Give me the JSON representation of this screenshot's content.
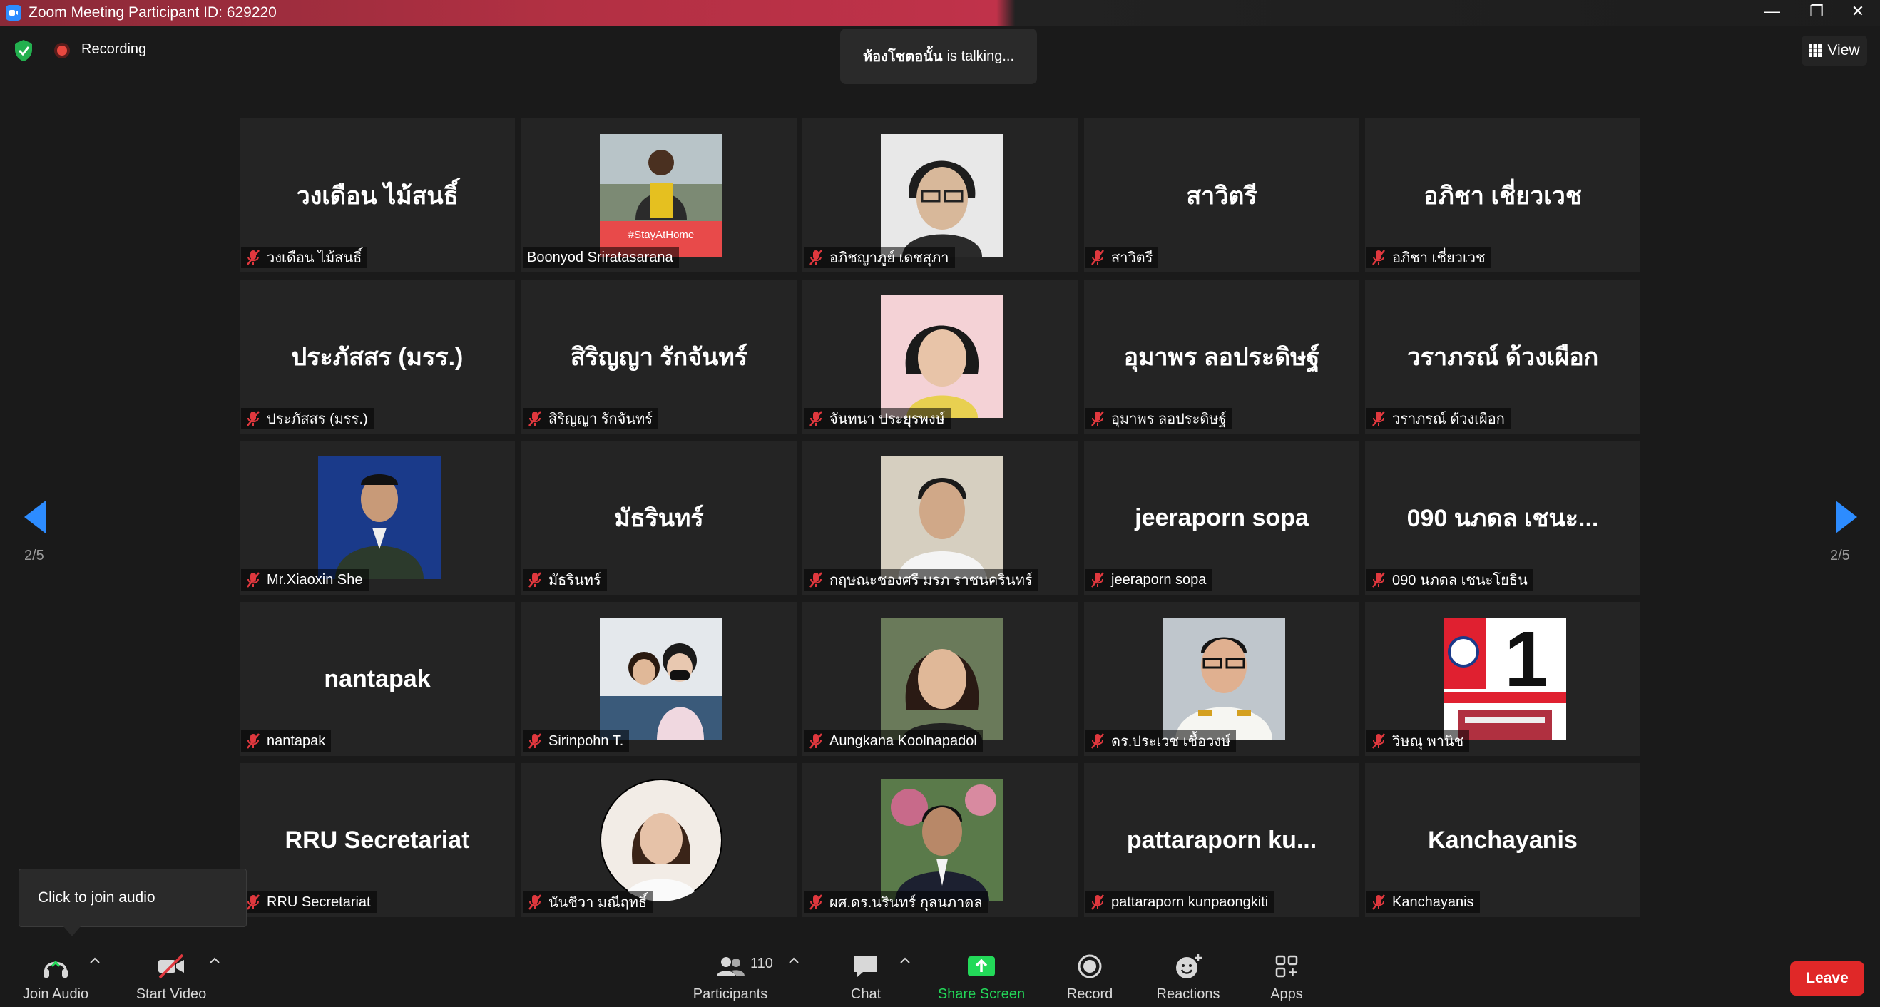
{
  "window": {
    "title": "Zoom Meeting Participant ID: 629220",
    "minimize": "—",
    "restore": "❐",
    "close": "✕"
  },
  "topbar": {
    "recording": "Recording",
    "talking_name": "ห้องโชตอนั้น",
    "talking_suffix": "is  talking...",
    "view": "View"
  },
  "pagination": {
    "left": "2/5",
    "right": "2/5"
  },
  "participants": [
    {
      "big": "วงเดือน ไม้สนธิ์",
      "tag": "วงเดือน ไม้สนธิ์",
      "muted": true,
      "photo": ""
    },
    {
      "big": "",
      "tag": "Boonyod Sriratasarana",
      "muted": false,
      "photo": "stayathome",
      "photo_caption": "#StayAtHome"
    },
    {
      "big": "",
      "tag": "อภิชญาภูย์ เดชสุภา",
      "muted": true,
      "photo": "man-glasses"
    },
    {
      "big": "สาวิตรี",
      "tag": "สาวิตรี",
      "muted": true,
      "photo": ""
    },
    {
      "big": "อภิชา เชี่ยวเวช",
      "tag": "อภิชา เชี่ยวเวช",
      "muted": true,
      "photo": ""
    },
    {
      "big": "ประภัสสร (มรร.)",
      "tag": "ประภัสสร (มรร.)",
      "muted": true,
      "photo": ""
    },
    {
      "big": "สิริญญา  รักจันทร์",
      "tag": "สิริญญา  รักจันทร์",
      "muted": true,
      "photo": ""
    },
    {
      "big": "",
      "tag": "จันทนา ประยุรพงษ์",
      "muted": true,
      "photo": "woman-pink"
    },
    {
      "big": "อุมาพร ลอประดิษฐ์",
      "tag": "อุมาพร ลอประดิษฐ์",
      "muted": true,
      "photo": ""
    },
    {
      "big": "วราภรณ์ ด้วงเผือก",
      "tag": "วราภรณ์ ด้วงเผือก",
      "muted": true,
      "photo": ""
    },
    {
      "big": "",
      "tag": "Mr.Xiaoxin She",
      "muted": true,
      "photo": "uniform-blue"
    },
    {
      "big": "มัธรินทร์",
      "tag": "มัธรินทร์",
      "muted": true,
      "photo": ""
    },
    {
      "big": "",
      "tag": "กฤษณะชองศรี มรภ ราชนครินทร์",
      "muted": true,
      "photo": "man-white"
    },
    {
      "big": "jeeraporn sopa",
      "tag": "jeeraporn sopa",
      "muted": true,
      "photo": ""
    },
    {
      "big": "090 นภดล  เชนะ...",
      "tag": "090 นภดล  เชนะโยธิน",
      "muted": true,
      "photo": ""
    },
    {
      "big": "nantapak",
      "tag": "nantapak",
      "muted": true,
      "photo": ""
    },
    {
      "big": "",
      "tag": "Sirinpohn T.",
      "muted": true,
      "photo": "two-women"
    },
    {
      "big": "",
      "tag": "Aungkana Koolnapadol",
      "muted": true,
      "photo": "woman-smile"
    },
    {
      "big": "",
      "tag": "ดร.ประเวช เชื้อวงษ์",
      "muted": true,
      "photo": "uniform-white"
    },
    {
      "big": "",
      "tag": "วิษณุ พานิช",
      "muted": true,
      "photo": "logo-1",
      "photo_caption": "1"
    },
    {
      "big": "RRU Secretariat",
      "tag": "RRU Secretariat",
      "muted": true,
      "photo": ""
    },
    {
      "big": "",
      "tag": "นันชิวา มณีฤทธิ์",
      "muted": true,
      "photo": "woman-circle"
    },
    {
      "big": "",
      "tag": "ผศ.ดร.นรินทร์ กุลนภาดล",
      "muted": true,
      "photo": "man-suit"
    },
    {
      "big": "pattaraporn ku...",
      "tag": "pattaraporn kunpaongkiti",
      "muted": true,
      "photo": ""
    },
    {
      "big": "Kanchayanis",
      "tag": "Kanchayanis",
      "muted": true,
      "photo": ""
    }
  ],
  "tooltip": {
    "text": "Click to join audio"
  },
  "toolbar": {
    "join_audio": "Join Audio",
    "start_video": "Start Video",
    "participants": "Participants",
    "participants_count": "110",
    "chat": "Chat",
    "share_screen": "Share Screen",
    "record": "Record",
    "reactions": "Reactions",
    "apps": "Apps",
    "leave": "Leave"
  },
  "colors": {
    "share_green": "#23d959",
    "leave_red": "#e02828",
    "accent_blue": "#2d8cff",
    "muted_red": "#e0383e"
  }
}
